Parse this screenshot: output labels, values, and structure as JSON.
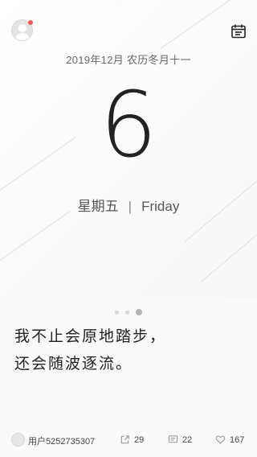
{
  "header": {
    "avatar_icon": "user-avatar-icon",
    "notification_dot_color": "#f25a5a",
    "calendar_icon": "calendar-icon"
  },
  "date": {
    "full_date": "2019年12月 农历冬月十一",
    "day_number": "6",
    "weekday_cn": "星期五",
    "separator": "|",
    "weekday_en": "Friday"
  },
  "pager": {
    "count": 3,
    "active_index": 2
  },
  "quote": {
    "line1": "我不止会原地踏步，",
    "line2": "还会随波逐流。"
  },
  "footer": {
    "username": "用户5252735307",
    "shares": "29",
    "comments": "22",
    "likes": "167",
    "share_icon": "share-icon",
    "comment_icon": "comment-icon",
    "like_icon": "heart-icon"
  }
}
